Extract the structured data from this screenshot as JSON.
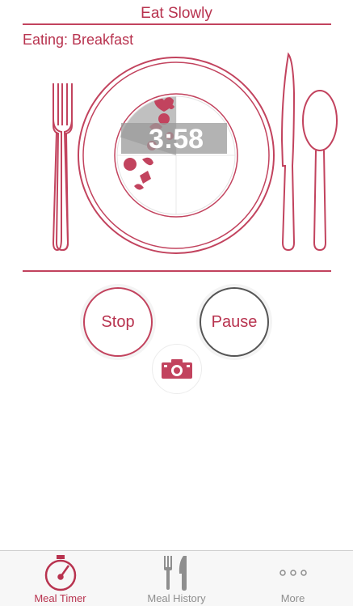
{
  "header": {
    "title": "Eat Slowly"
  },
  "meal": {
    "label": "Eating: Breakfast"
  },
  "timer": {
    "display": "3:58",
    "elapsed_fraction": 0.2
  },
  "controls": {
    "stop_label": "Stop",
    "pause_label": "Pause",
    "camera_icon": "camera-icon"
  },
  "tabbar": {
    "tabs": [
      {
        "label": "Meal Timer",
        "icon": "stopwatch-icon",
        "active": true
      },
      {
        "label": "Meal History",
        "icon": "fork-knife-icon",
        "active": false
      },
      {
        "label": "More",
        "icon": "more-dots-icon",
        "active": false
      }
    ]
  },
  "colors": {
    "accent": "#b8334f",
    "inactive": "#8e8e8e",
    "timer_overlay": "#9a9a9a"
  }
}
